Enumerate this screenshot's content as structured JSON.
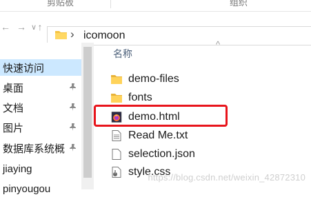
{
  "ribbon": {
    "group1": "剪贴板",
    "group2": "组织"
  },
  "nav": {
    "back": "←",
    "forward": "→",
    "recent": "∨",
    "up": "↑"
  },
  "address": {
    "separator": "›",
    "current_folder": "icomoon"
  },
  "sidebar": {
    "items": [
      {
        "label": "快速访问",
        "selected": true,
        "pinned": false
      },
      {
        "label": "桌面",
        "pinned": true
      },
      {
        "label": "文档",
        "pinned": true
      },
      {
        "label": "图片",
        "pinned": true
      },
      {
        "label": "数据库系统概",
        "pinned": true
      },
      {
        "label": "jiaying",
        "pinned": false
      },
      {
        "label": "pinyougou",
        "pinned": false
      }
    ],
    "pin_glyph": "📌"
  },
  "content": {
    "column_header": "名称",
    "sort_glyph": "^",
    "files": [
      {
        "name": "demo-files",
        "icon": "folder-icon"
      },
      {
        "name": "fonts",
        "icon": "folder-icon"
      },
      {
        "name": "demo.html",
        "icon": "html-file-icon",
        "highlighted": true
      },
      {
        "name": "Read Me.txt",
        "icon": "text-file-icon"
      },
      {
        "name": "selection.json",
        "icon": "json-file-icon"
      },
      {
        "name": "style.css",
        "icon": "css-file-icon"
      }
    ]
  },
  "watermark": "https://blog.csdn.net/weixin_42872310",
  "colors": {
    "highlight_border": "#e8141b",
    "selected_bg": "#cce8ff",
    "folder": "#f5c443"
  }
}
